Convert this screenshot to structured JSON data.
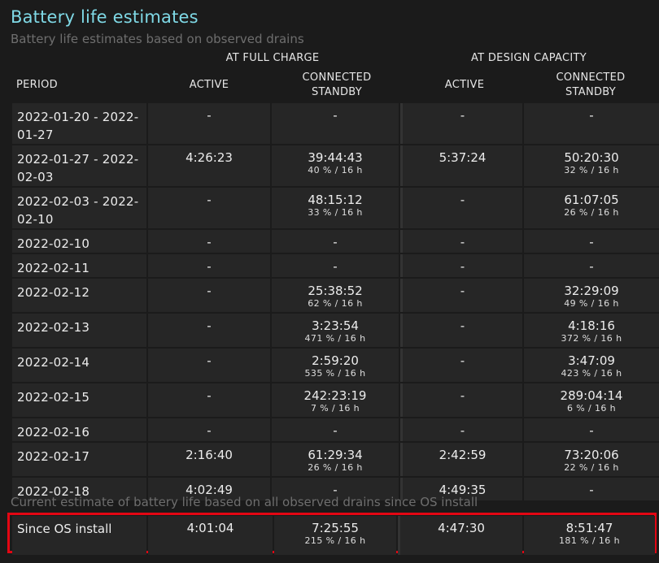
{
  "title": "Battery life estimates",
  "subtitle": "Battery life estimates based on observed drains",
  "groups": {
    "full_charge": "AT FULL CHARGE",
    "design_capacity": "AT DESIGN CAPACITY"
  },
  "columns": {
    "period": "PERIOD",
    "active_full": "ACTIVE",
    "standby_full": [
      "CONNECTED",
      "STANDBY"
    ],
    "active_design": "ACTIVE",
    "standby_design": [
      "CONNECTED",
      "STANDBY"
    ]
  },
  "rows": [
    {
      "period": [
        "2022-01-20 - 2022-",
        "01-27"
      ],
      "active_full": "-",
      "standby_full": "-",
      "standby_full_sub": "",
      "active_design": "-",
      "standby_design": "-",
      "standby_design_sub": ""
    },
    {
      "period": [
        "2022-01-27 - 2022-",
        "02-03"
      ],
      "active_full": "4:26:23",
      "standby_full": "39:44:43",
      "standby_full_sub": "40 % / 16 h",
      "active_design": "5:37:24",
      "standby_design": "50:20:30",
      "standby_design_sub": "32 % / 16 h"
    },
    {
      "period": [
        "2022-02-03 - 2022-",
        "02-10"
      ],
      "active_full": "-",
      "standby_full": "48:15:12",
      "standby_full_sub": "33 % / 16 h",
      "active_design": "-",
      "standby_design": "61:07:05",
      "standby_design_sub": "26 % / 16 h"
    },
    {
      "period": [
        "2022-02-10"
      ],
      "active_full": "-",
      "standby_full": "-",
      "standby_full_sub": "",
      "active_design": "-",
      "standby_design": "-",
      "standby_design_sub": ""
    },
    {
      "period": [
        "2022-02-11"
      ],
      "active_full": "-",
      "standby_full": "-",
      "standby_full_sub": "",
      "active_design": "-",
      "standby_design": "-",
      "standby_design_sub": ""
    },
    {
      "period": [
        "2022-02-12"
      ],
      "active_full": "-",
      "standby_full": "25:38:52",
      "standby_full_sub": "62 % / 16 h",
      "active_design": "-",
      "standby_design": "32:29:09",
      "standby_design_sub": "49 % / 16 h"
    },
    {
      "period": [
        "2022-02-13"
      ],
      "active_full": "-",
      "standby_full": "3:23:54",
      "standby_full_sub": "471 % / 16 h",
      "active_design": "-",
      "standby_design": "4:18:16",
      "standby_design_sub": "372 % / 16 h"
    },
    {
      "period": [
        "2022-02-14"
      ],
      "active_full": "-",
      "standby_full": "2:59:20",
      "standby_full_sub": "535 % / 16 h",
      "active_design": "-",
      "standby_design": "3:47:09",
      "standby_design_sub": "423 % / 16 h"
    },
    {
      "period": [
        "2022-02-15"
      ],
      "active_full": "-",
      "standby_full": "242:23:19",
      "standby_full_sub": "7 % / 16 h",
      "active_design": "-",
      "standby_design": "289:04:14",
      "standby_design_sub": "6 % / 16 h"
    },
    {
      "period": [
        "2022-02-16"
      ],
      "active_full": "-",
      "standby_full": "-",
      "standby_full_sub": "",
      "active_design": "-",
      "standby_design": "-",
      "standby_design_sub": ""
    },
    {
      "period": [
        "2022-02-17"
      ],
      "active_full": "2:16:40",
      "standby_full": "61:29:34",
      "standby_full_sub": "26 % / 16 h",
      "active_design": "2:42:59",
      "standby_design": "73:20:06",
      "standby_design_sub": "22 % / 16 h"
    },
    {
      "period": [
        "2022-02-18"
      ],
      "active_full": "4:02:49",
      "standby_full": "-",
      "standby_full_sub": "",
      "active_design": "4:49:35",
      "standby_design": "-",
      "standby_design_sub": ""
    }
  ],
  "since_caption": "Current estimate of battery life based on all observed drains since OS install",
  "since_row": {
    "period": "Since OS install",
    "active_full": "4:01:04",
    "standby_full": "7:25:55",
    "standby_full_sub": "215 % / 16 h",
    "active_design": "4:47:30",
    "standby_design": "8:51:47",
    "standby_design_sub": "181 % / 16 h"
  },
  "colors": {
    "title": "#7fd9e6",
    "highlight_border": "#e30613",
    "cell_bg": "#262626",
    "page_bg": "#1b1b1b"
  }
}
